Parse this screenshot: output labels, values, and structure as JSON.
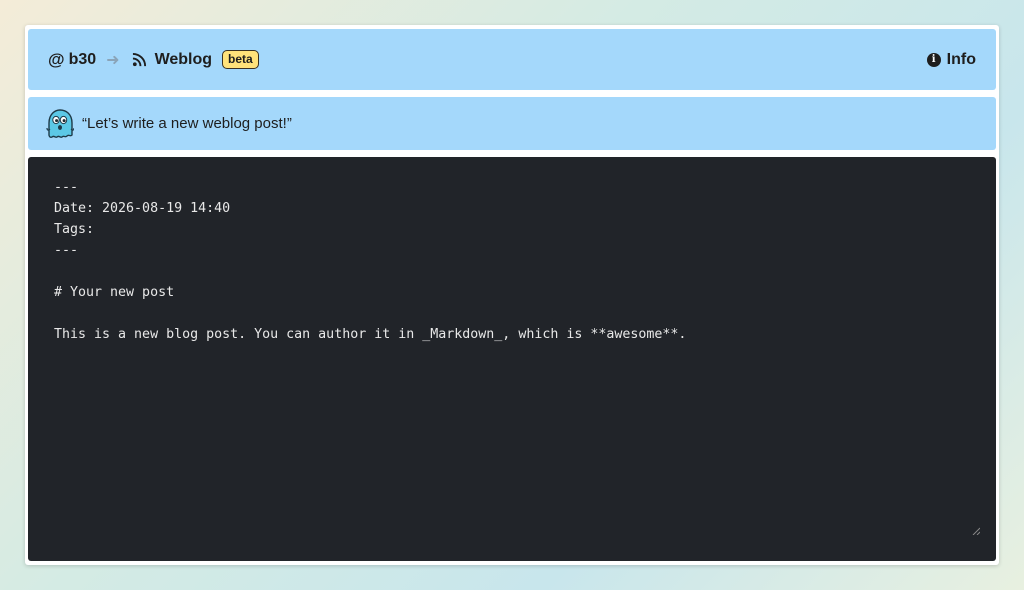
{
  "header": {
    "handle": "b30",
    "section": "Weblog",
    "badge": "beta",
    "info_label": "Info"
  },
  "banner": {
    "message": "“Let’s write a new weblog post!”"
  },
  "editor": {
    "content": "---\nDate: 2026-08-19 14:40\nTags:\n---\n\n# Your new post\n\nThis is a new blog post. You can author it in _Markdown_, which is **awesome**."
  },
  "colors": {
    "header_bg": "#a4d8fb",
    "badge_bg": "#ffe27a",
    "editor_bg": "#212429"
  }
}
